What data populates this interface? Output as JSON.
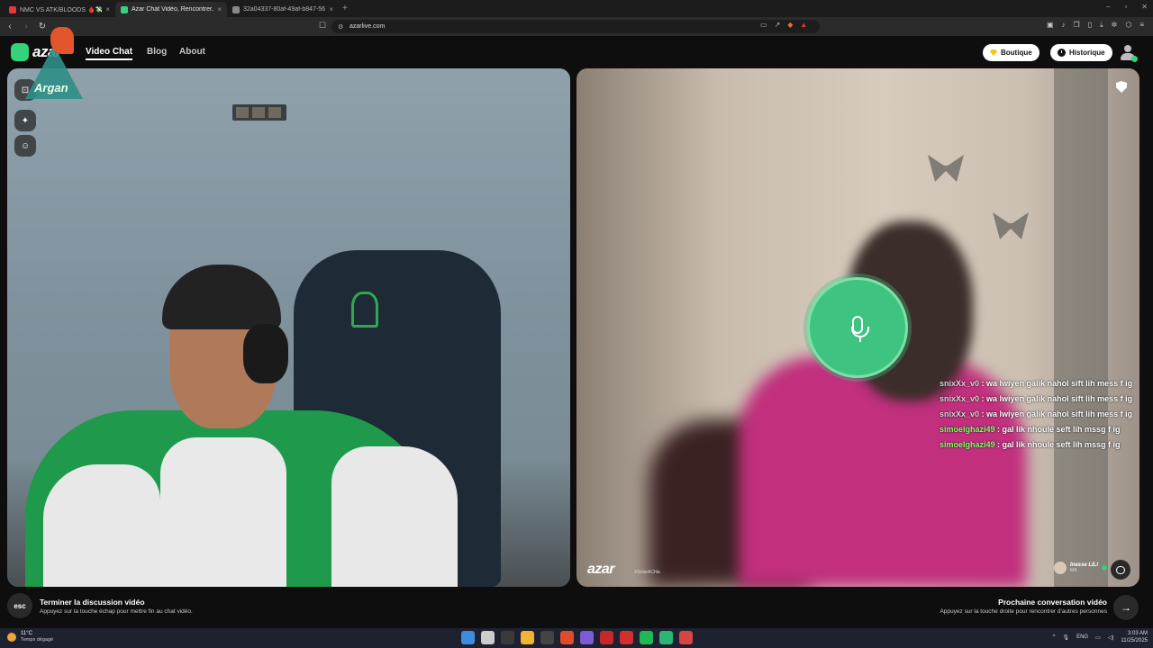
{
  "browser": {
    "tabs": [
      {
        "title": "NMC VS ATK/BLOODS 🩸💸 - YouTube",
        "color": "#e53935"
      },
      {
        "title": "Azar Chat Vidéo, Rencontrer...",
        "color": "#34d27a"
      },
      {
        "title": "32a04337-80af-49af-b847-568d818...",
        "color": "#888888"
      }
    ],
    "url": "azarlive.com"
  },
  "header": {
    "logo": "azar",
    "nav": [
      "Video Chat",
      "Blog",
      "About"
    ],
    "shop_label": "Boutique",
    "history_label": "Historique"
  },
  "overlay": {
    "watermark_text": "Argan"
  },
  "remote": {
    "chat": [
      {
        "user": "snixXx_v0",
        "msg": " : wa lwiyen galik nahol sift lih mess f ig",
        "style": "u1"
      },
      {
        "user": "snixXx_v0",
        "msg": " : wa lwiyen galik nahol sift lih mess f ig",
        "style": "u1"
      },
      {
        "user": "snixXx_v0",
        "msg": " : wa lwiyen galik nahol sift lih mess f ig",
        "style": "u1"
      },
      {
        "user": "simoelghazi49",
        "msg": " : gal lik nhoule seft lih mssg f ig",
        "style": "u2"
      },
      {
        "user": "simoelghazi49",
        "msg": " : gal lik nhoule seft lih mssg f ig",
        "style": "u2"
      }
    ],
    "brand": "azar",
    "brand_sub": "XSolarAChla",
    "partner_name": "Inesse LILI",
    "partner_country": "MA"
  },
  "footer": {
    "esc_key": "esc",
    "end_title": "Terminer la discussion vidéo",
    "end_sub": "Appuyez sur la touche échap pour mettre fin au chat vidéo.",
    "next_title": "Prochaine conversation vidéo",
    "next_sub": "Appuyez sur la touche droite pour rencontrer d'autres personnes"
  },
  "taskbar": {
    "temp": "11°C",
    "weather": "Temps dégagé",
    "lang": "ENG",
    "time": "3:03 AM",
    "date": "11/25/2025",
    "app_colors": [
      "#3a8dde",
      "#cccccc",
      "#3a3a3a",
      "#f2b233",
      "#444444",
      "#e24a2c",
      "#7b5cd6",
      "#c62828",
      "#d32f2f",
      "#1db954",
      "#2bb673",
      "#d84343"
    ]
  }
}
